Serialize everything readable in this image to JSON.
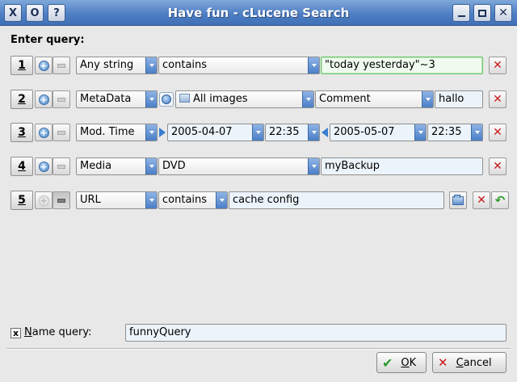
{
  "window": {
    "title": "Have fun - cLucene Search",
    "left_buttons": [
      "X",
      "O",
      "?"
    ]
  },
  "heading": "Enter query:",
  "rows": [
    {
      "number": "1",
      "field": "Any string",
      "operator": "contains",
      "value": "\"today yesterday\"~3"
    },
    {
      "number": "2",
      "field": "MetaData",
      "category": "All images",
      "property": "Comment",
      "value": "hallo"
    },
    {
      "number": "3",
      "field": "Mod. Time",
      "from_date": "2005-04-07",
      "from_time": "22:35",
      "to_date": "2005-05-07",
      "to_time": "22:35"
    },
    {
      "number": "4",
      "field": "Media",
      "medium": "DVD",
      "value": "myBackup"
    },
    {
      "number": "5",
      "field": "URL",
      "operator": "contains",
      "value": "cache config"
    }
  ],
  "name_query": {
    "checked": "x",
    "label_first": "N",
    "label_rest": "ame query:",
    "value": "funnyQuery"
  },
  "buttons": {
    "ok_first": "O",
    "ok_rest": "K",
    "cancel_first": "C",
    "cancel_rest": "ancel"
  }
}
